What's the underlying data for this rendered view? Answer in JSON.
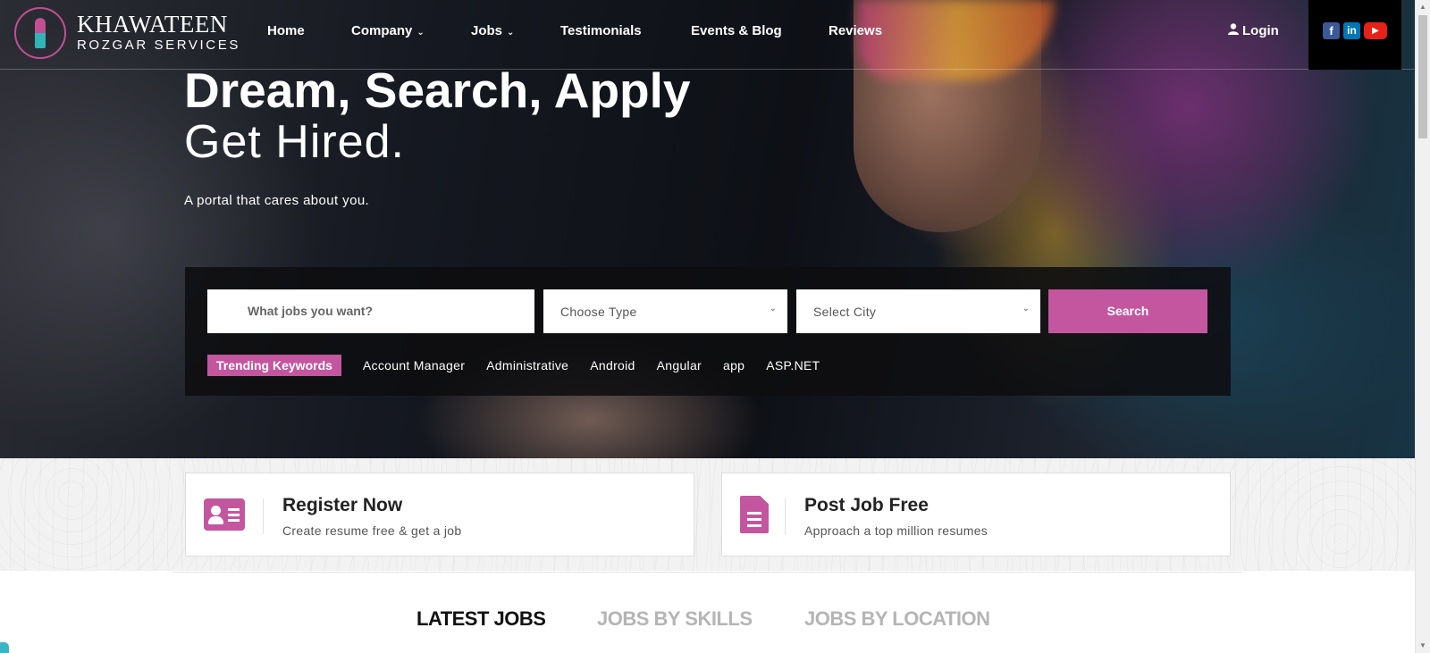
{
  "brand": {
    "name": "KHAWATEEN",
    "sub": "ROZGAR SERVICES",
    "colors": {
      "accent": "#c4569f",
      "teal": "#2fb5b8"
    }
  },
  "nav": {
    "items": [
      {
        "label": "Home",
        "has_dropdown": false
      },
      {
        "label": "Company",
        "has_dropdown": true
      },
      {
        "label": "Jobs",
        "has_dropdown": true
      },
      {
        "label": "Testimonials",
        "has_dropdown": false
      },
      {
        "label": "Events & Blog",
        "has_dropdown": false
      },
      {
        "label": "Reviews",
        "has_dropdown": false
      }
    ],
    "caret": "⌄",
    "login": "Login",
    "social": [
      {
        "icon": "facebook-icon",
        "glyph": "f"
      },
      {
        "icon": "linkedin-icon",
        "glyph": "in"
      },
      {
        "icon": "youtube-icon",
        "glyph": "▶"
      }
    ]
  },
  "hero": {
    "headline": "Dream, Search, Apply",
    "subheadline": "Get Hired.",
    "tagline": "A portal that cares about you."
  },
  "search": {
    "jobs_placeholder": "What jobs you want?",
    "type_select": "Choose Type",
    "city_select": "Select City",
    "button": "Search",
    "trending_label": "Trending Keywords",
    "keywords": [
      "Account Manager",
      "Administrative",
      "Android",
      "Angular",
      "app",
      "ASP.NET"
    ]
  },
  "cta": {
    "register": {
      "title": "Register Now",
      "desc": "Create resume free & get a job",
      "icon": "id-card-icon"
    },
    "post": {
      "title": "Post Job Free",
      "desc": "Approach a top million resumes",
      "icon": "document-icon"
    }
  },
  "tabs": [
    {
      "label": "LATEST JOBS",
      "active": true
    },
    {
      "label": "JOBS BY SKILLS",
      "active": false
    },
    {
      "label": "JOBS BY LOCATION",
      "active": false
    }
  ]
}
